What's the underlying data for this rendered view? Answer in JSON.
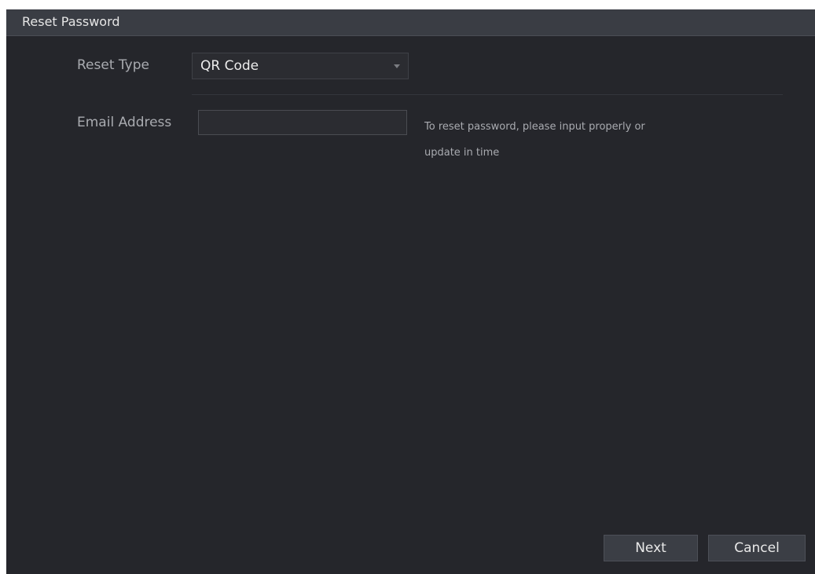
{
  "dialog": {
    "title": "Reset Password"
  },
  "form": {
    "reset_type": {
      "label": "Reset Type",
      "value": "QR Code"
    },
    "email": {
      "label": "Email Address",
      "value": "",
      "placeholder": "",
      "hint_line1": "To reset password, please input properly or",
      "hint_line2": "update in time"
    }
  },
  "footer": {
    "next_label": "Next",
    "cancel_label": "Cancel"
  },
  "colors": {
    "background": "#25262b",
    "titlebar": "#3a3d44",
    "button": "#3b3e45",
    "label_text": "#a9abb0",
    "value_text": "#ececec"
  },
  "icons": {
    "dropdown": "chevron-down-icon"
  }
}
